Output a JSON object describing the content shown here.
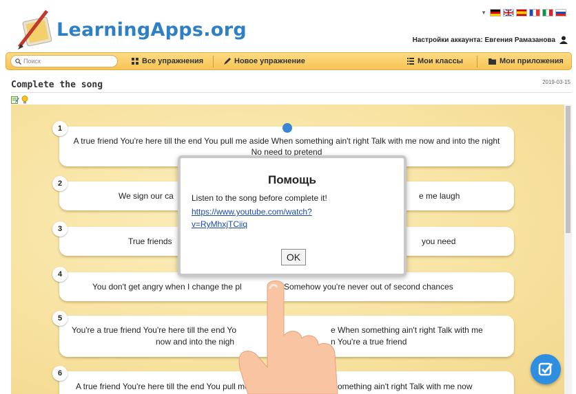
{
  "header": {
    "logo_text": "LearningApps.org",
    "account_label": "Настройки аккаунта: Евгения Рамазанова",
    "flags": [
      "de",
      "gb",
      "es",
      "fr",
      "it",
      "ru"
    ]
  },
  "navbar": {
    "search_placeholder": "Поиск",
    "items": [
      "Все упражнения",
      "Новое упражнение",
      "Мои классы",
      "Мои приложения"
    ]
  },
  "page": {
    "title": "Complete the song",
    "date": "2019-03-15"
  },
  "cards": [
    {
      "number": "1",
      "text": "A true friend You're here till the end You pull me aside When something ain't right Talk with me now and into the night No need to pretend"
    },
    {
      "number": "2",
      "text": "We sign our ca",
      "text_right": "e me laugh"
    },
    {
      "number": "3",
      "text": "True friends",
      "text_right": "you need"
    },
    {
      "number": "4",
      "text": "You don't get angry when I change the pl",
      "text_right": "Somehow you're never out of second chances"
    },
    {
      "number": "5",
      "text_line1_left": "You're a true friend You're here till the end Yo",
      "text_line1_right": "e When something ain't right Talk with me",
      "text_line2_left": "now and into the nigh",
      "text_line2_right": "n You're a true friend"
    },
    {
      "number": "6",
      "text_left": "A true friend You're here till the end You pull me",
      "text_right": "something ain't right Talk with me now"
    }
  ],
  "modal": {
    "title": "Помощь",
    "text": "Listen to the song before complete it!",
    "link_line1": "https://www.youtube.com/watch?",
    "link_line2": "v=RyMhxjTCiiq",
    "ok_label": "OK"
  },
  "colors": {
    "accent_blue": "#2e8fe0",
    "navbar": "#f7c456",
    "background": "#f6df9a"
  }
}
